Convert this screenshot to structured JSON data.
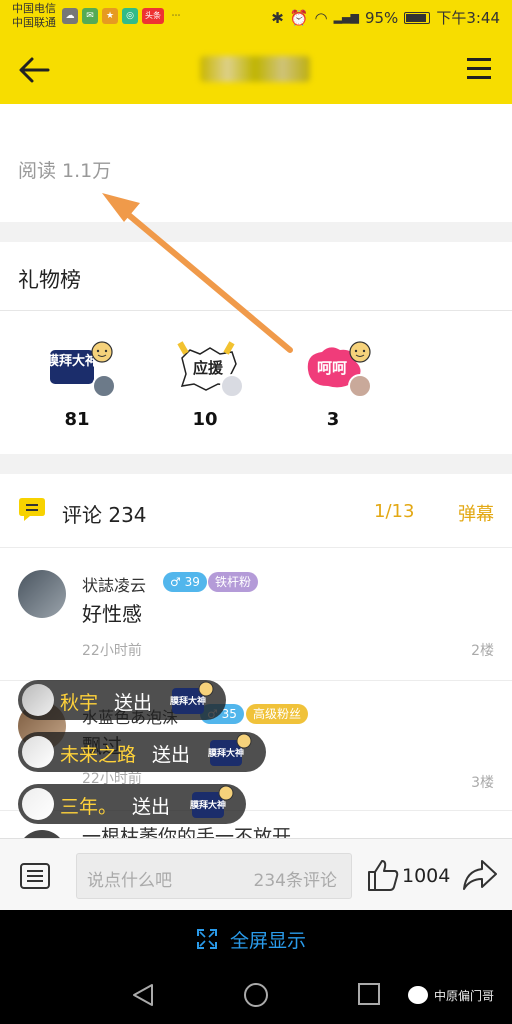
{
  "status_bar": {
    "carrier1": "中国电信",
    "carrier2": "中国联通",
    "battery": "95%",
    "time": "下午3:44",
    "notif_badge": "头条"
  },
  "read": {
    "label": "阅读 1.1万"
  },
  "gift_board": {
    "title": "礼物榜",
    "gifts": [
      {
        "badge": "膜拜大神",
        "count": "81"
      },
      {
        "badge": "应援",
        "count": "10"
      },
      {
        "badge": "呵呵",
        "count": "3"
      }
    ]
  },
  "comments": {
    "title": "评论 234",
    "page": "1/13",
    "danmu": "弹幕",
    "items": [
      {
        "name": "状誌凌云",
        "gender_level": "♂ 39",
        "fan_tag": "铁杆粉",
        "text": "好性感",
        "time": "22小时前",
        "floor": "2楼"
      },
      {
        "name": "水蓝色あ泡沫",
        "gender_level": "♂ 35",
        "fan_tag": "高级粉丝",
        "text": "飘过",
        "time": "22小时前",
        "floor": "3楼"
      },
      {
        "name": "一根枯萎你的手一不放开"
      }
    ]
  },
  "danmu_pills": [
    {
      "name": "秋宇",
      "action": "送出",
      "gift": "膜拜大神"
    },
    {
      "name": "未来之路",
      "action": "送出",
      "gift": "膜拜大神"
    },
    {
      "name": "三年。",
      "action": "送出",
      "gift": "膜拜大神"
    }
  ],
  "bottom_bar": {
    "input_placeholder": "说点什么吧",
    "comment_count": "234条评论",
    "like_count": "1004"
  },
  "fullscreen": {
    "label": "全屏显示"
  },
  "watermark": {
    "text": "中原偏门哥"
  },
  "colors": {
    "brand_yellow": "#f7dd00",
    "accent_gold": "#e3a814",
    "link_blue": "#2a9bea"
  }
}
